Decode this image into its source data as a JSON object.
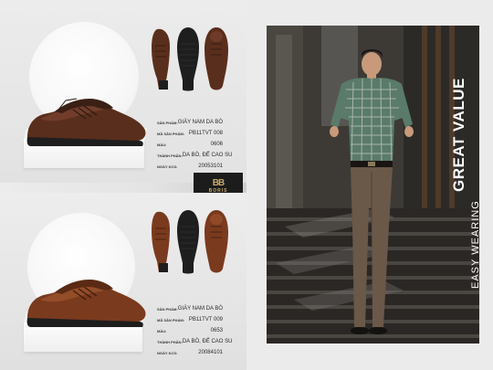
{
  "products": [
    {
      "specs": [
        {
          "label": "SẢN PHẨM:",
          "value": "GIÀY NAM DA BÒ"
        },
        {
          "label": "MÃ SẢN PHẨM:",
          "value": "PB11TVT 008"
        },
        {
          "label": "MÀU:",
          "value": "0606"
        },
        {
          "label": "THÀNH PHẦN:",
          "value": "DA BÒ, ĐẾ CAO SU"
        },
        {
          "label": "NGÀY KCS:",
          "value": "20053101"
        }
      ],
      "shoe_color": "#5a2e1c",
      "shoe_highlight": "#7a4530"
    },
    {
      "specs": [
        {
          "label": "SẢN PHẨM:",
          "value": "GIÀY NAM DA BÒ"
        },
        {
          "label": "MÃ SẢN PHẨM:",
          "value": "PB11TVT 009"
        },
        {
          "label": "MÀU:",
          "value": "0653"
        },
        {
          "label": "THÀNH PHẦN:",
          "value": "DA BÒ, ĐẾ CAO SU"
        },
        {
          "label": "NGÀY KCS:",
          "value": "20084101"
        }
      ],
      "shoe_color": "#7a3a1e",
      "shoe_highlight": "#a0552e"
    }
  ],
  "logo": {
    "mark": "BB",
    "text": "BORIS"
  },
  "banner": {
    "line1": "EASY WEARING",
    "line2": "GREAT VALUE"
  },
  "colors": {
    "accent_gold": "#c9a86a",
    "background": "#ebebeb"
  }
}
